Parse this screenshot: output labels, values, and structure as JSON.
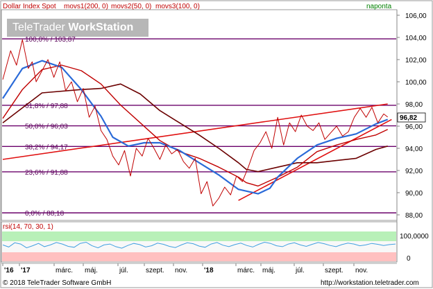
{
  "header": {
    "instrument": "Dollar Index Spot",
    "ma_labels": [
      "movs1(200, 0)",
      "movs2(50, 0)",
      "movs3(100, 0)"
    ],
    "period": "naponta"
  },
  "watermark": {
    "brand": "TeleTrader",
    "product": "WorkStation"
  },
  "price_axis": {
    "ticks": [
      "106,00",
      "104,00",
      "102,00",
      "100,00",
      "98,00",
      "96,00",
      "94,00",
      "92,00",
      "90,00",
      "88,00"
    ],
    "last_price": "96,82"
  },
  "fibonacci": [
    {
      "label": "100,0% / 103,87",
      "value": 103.87
    },
    {
      "label": "61,8% / 97,88",
      "value": 97.88
    },
    {
      "label": "50,0% / 96,03",
      "value": 96.03
    },
    {
      "label": "38,2% / 94,17",
      "value": 94.17
    },
    {
      "label": "23,6% / 91,88",
      "value": 91.88
    },
    {
      "label": "0,0% / 88,18",
      "value": 88.18
    }
  ],
  "rsi": {
    "label": "rsi(14, 70, 30, 1)",
    "ticks": [
      "100,0000",
      "0"
    ]
  },
  "time_axis": [
    "'16",
    "'17",
    "márc.",
    "máj.",
    "júl.",
    "szept.",
    "nov.",
    "'18",
    "márc.",
    "máj.",
    "júl.",
    "szept.",
    "nov."
  ],
  "footer": {
    "copyright": "© 2018 TeleTrader Software GmbH",
    "url": "http://workstation.teletrader.com"
  },
  "colors": {
    "price": "#c00000",
    "ma1": "#6b0000",
    "ma2": "#2a6ad8",
    "ma3": "#c00000",
    "fib": "#6a006a",
    "trend": "#e01010",
    "header_text": "#c00000",
    "period_text": "#008000"
  },
  "chart_data": {
    "type": "line",
    "y_range": [
      87.5,
      106.5
    ],
    "x_range": [
      0,
      100
    ],
    "series": [
      {
        "name": "Dollar Index Spot",
        "x": [
          0,
          2,
          3.5,
          5,
          6.5,
          7.5,
          8.5,
          10,
          11.5,
          13,
          14.5,
          16,
          17.5,
          19,
          20.5,
          22,
          23.5,
          25,
          26.5,
          28,
          29.5,
          31,
          32.5,
          34,
          35.5,
          37,
          38.5,
          40,
          41.5,
          43,
          44.5,
          46,
          47.5,
          49,
          50.5,
          52,
          53.5,
          55,
          56.5,
          58,
          59.5,
          61,
          62.5,
          64,
          65.5,
          67,
          68.5,
          70,
          71.5,
          73,
          74.5,
          76,
          77.5,
          79,
          80.5,
          82,
          83.5,
          85,
          86.5,
          88,
          89.5,
          91,
          92.5,
          94,
          95.5,
          97,
          98
        ],
        "y": [
          100.2,
          102.8,
          101.5,
          103.8,
          101.2,
          101.8,
          100.0,
          101.0,
          102.0,
          100.4,
          101.8,
          99.2,
          100.0,
          98.2,
          99.4,
          96.8,
          97.8,
          95.6,
          94.8,
          93.3,
          92.5,
          93.8,
          91.5,
          94.0,
          93.3,
          94.9,
          94.0,
          93.0,
          94.3,
          93.5,
          93.9,
          92.8,
          92.2,
          93.1,
          89.9,
          91.0,
          88.8,
          89.5,
          90.5,
          89.8,
          91.5,
          91.0,
          92.3,
          93.8,
          94.5,
          95.5,
          94.0,
          96.8,
          94.3,
          96.3,
          95.5,
          97.0,
          96.0,
          95.6,
          96.3,
          94.8,
          95.4,
          96.0,
          95.1,
          95.5,
          96.8,
          97.6,
          96.8,
          97.7,
          96.3,
          97.1,
          96.82
        ]
      },
      {
        "name": "movs1(200, 0)",
        "x": [
          0,
          10,
          20,
          25,
          30,
          35,
          40,
          45,
          50,
          55,
          60,
          62,
          65,
          70,
          75,
          80,
          85,
          90,
          95,
          98
        ],
        "y": [
          96.3,
          99.0,
          99.3,
          99.4,
          99.8,
          98.9,
          97.4,
          96.3,
          95.2,
          94.0,
          92.7,
          92.1,
          91.9,
          92.3,
          92.7,
          92.7,
          92.9,
          93.1,
          93.9,
          94.2
        ]
      },
      {
        "name": "movs2(50, 0)",
        "x": [
          0,
          5,
          10,
          15,
          20,
          25,
          28,
          32,
          36,
          40,
          45,
          50,
          55,
          60,
          65,
          68,
          70,
          75,
          80,
          85,
          90,
          95,
          98
        ],
        "y": [
          98.5,
          101.2,
          101.9,
          101.3,
          99.3,
          96.9,
          95.0,
          94.2,
          94.5,
          94.5,
          93.8,
          92.7,
          91.6,
          90.3,
          89.9,
          90.4,
          91.4,
          93.1,
          94.3,
          94.9,
          95.3,
          96.2,
          96.6
        ]
      },
      {
        "name": "movs3(100, 0)",
        "x": [
          0,
          5,
          10,
          15,
          20,
          25,
          30,
          35,
          40,
          45,
          50,
          55,
          60,
          62,
          65,
          70,
          75,
          80,
          85,
          90,
          95,
          98
        ],
        "y": [
          96.7,
          99.3,
          101.1,
          101.5,
          101.0,
          99.8,
          97.9,
          96.3,
          94.7,
          93.7,
          93.1,
          92.3,
          91.4,
          90.9,
          90.6,
          91.4,
          92.3,
          93.7,
          94.3,
          94.8,
          95.2,
          95.7
        ]
      }
    ],
    "trendlines": [
      {
        "x": [
          0,
          98
        ],
        "y": [
          93.0,
          98.0
        ]
      },
      {
        "x": [
          60,
          99
        ],
        "y": [
          89.3,
          96.6
        ]
      }
    ],
    "rsi_series": [
      55,
      48,
      62,
      58,
      45,
      52,
      60,
      49,
      55,
      63,
      58,
      50,
      47,
      60,
      64,
      52,
      45,
      55,
      58,
      49,
      44,
      53,
      60,
      56,
      48,
      52,
      61,
      57,
      50,
      46,
      55,
      62,
      59,
      51,
      47,
      58,
      63,
      54,
      49,
      56,
      61,
      53,
      48,
      57,
      64,
      60,
      52,
      49,
      58,
      62,
      55,
      50,
      57,
      63,
      59,
      53,
      49,
      56,
      61,
      58,
      52,
      55,
      60,
      57,
      53,
      56,
      58
    ]
  }
}
